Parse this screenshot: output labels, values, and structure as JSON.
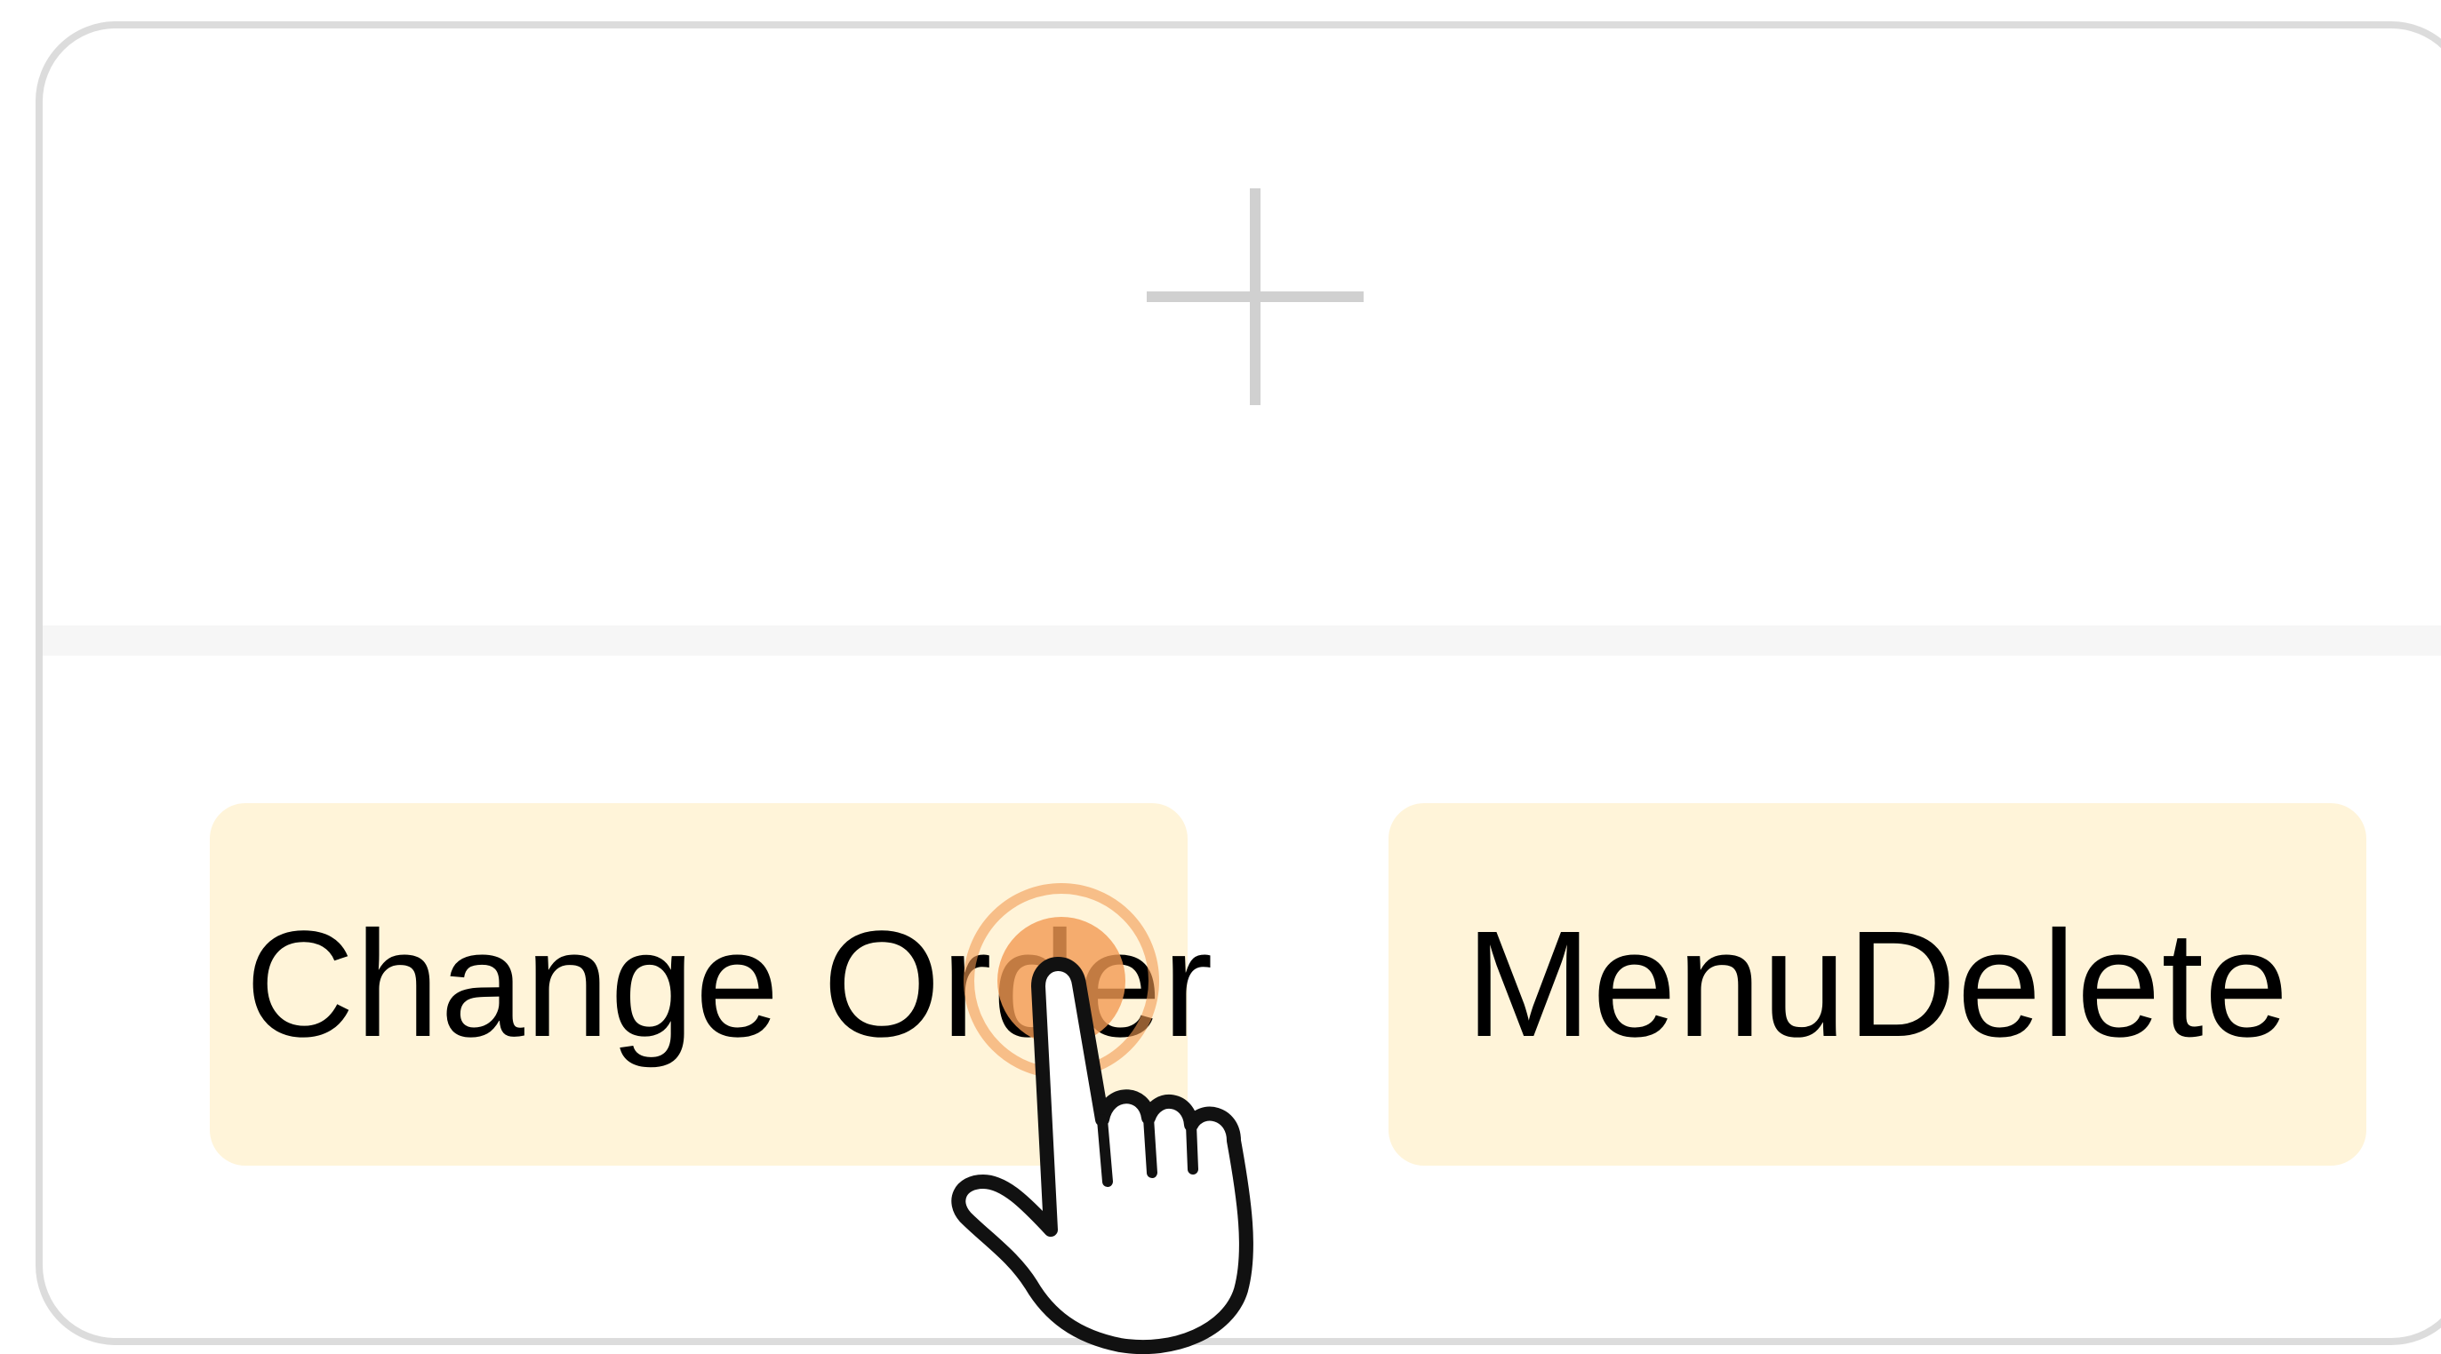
{
  "actions": {
    "change_order_label": "Change Order",
    "menu_delete_label": "MenuDelete"
  },
  "icons": {
    "add": "plus-icon",
    "pointer": "hand-pointer-icon"
  },
  "colors": {
    "button_bg": "#fff4d9",
    "border": "#dcdcdc",
    "plus": "#d0d0d0",
    "tap_highlight": "#f29a52"
  }
}
